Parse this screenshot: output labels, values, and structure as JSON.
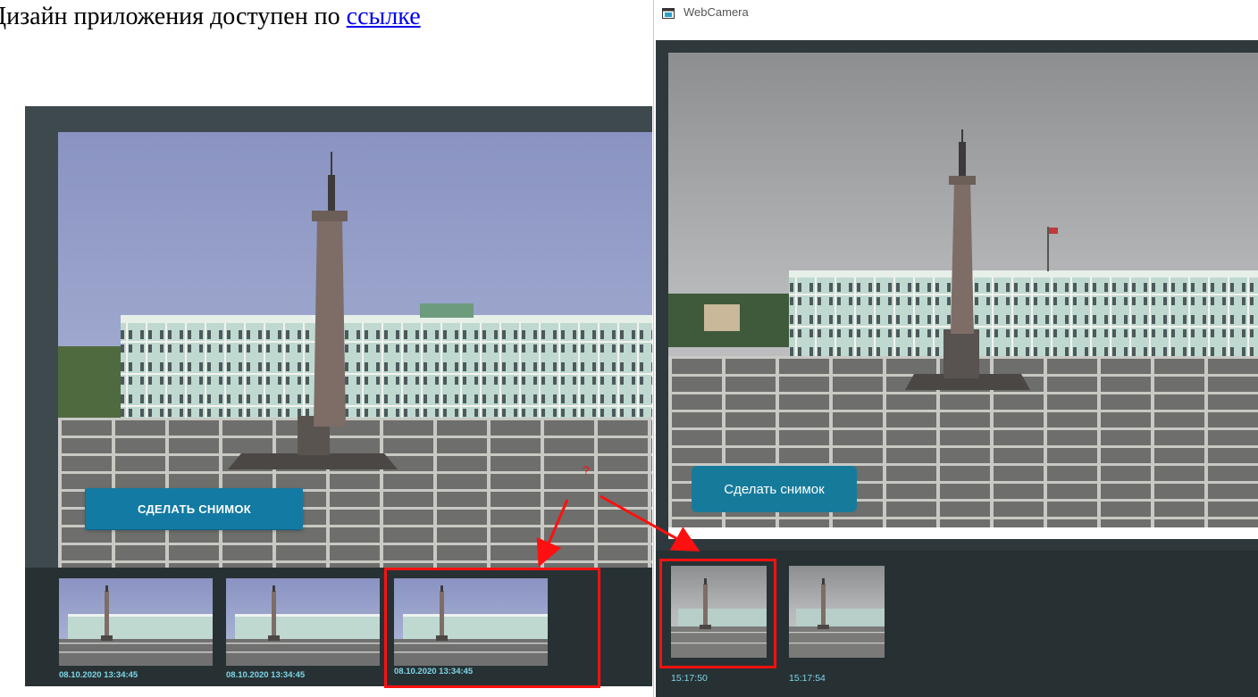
{
  "doc": {
    "heading_text": "Дизайн приложения доступен по ",
    "link_text": "ссылке"
  },
  "design": {
    "capture_button": "СДЕЛАТЬ СНИМОК",
    "question_mark": "?",
    "thumbnails": [
      {
        "time": "08.10.2020 13:34:45"
      },
      {
        "time": "08.10.2020 13:34:45"
      },
      {
        "time": "08.10.2020 13:34:45"
      }
    ]
  },
  "window": {
    "title": "WebCamera",
    "capture_button": "Сделать снимок",
    "thumbnails": [
      {
        "time": "15:17:50"
      },
      {
        "time": "15:17:54"
      }
    ]
  },
  "colors": {
    "highlight": "#ff1010",
    "button": "#137aa3",
    "timestamp": "#7fd6e8",
    "panel": "#3d494d",
    "strip": "#273134"
  },
  "icons": [
    "window-app-icon",
    "arrow-icon"
  ]
}
